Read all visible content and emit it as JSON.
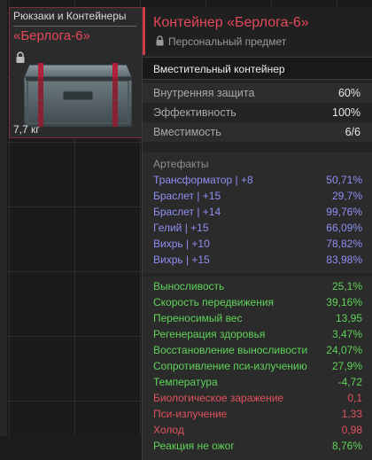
{
  "item_card": {
    "category": "Рюкзаки и Контейнеры",
    "name": "«Берлога-6»",
    "weight": "7,7 кг"
  },
  "tooltip": {
    "title": "Контейнер «Берлога-6»",
    "subtitle": "Персональный предмет",
    "type": "Вместительный контейнер",
    "stats": [
      {
        "label": "Внутренняя защита",
        "value": "60%"
      },
      {
        "label": "Эффективность",
        "value": "100%"
      },
      {
        "label": "Вместимость",
        "value": "6/6"
      }
    ],
    "artifacts_title": "Артефакты",
    "artifacts": [
      {
        "name": "Трансформатор | +8",
        "value": "50,71%"
      },
      {
        "name": "Браслет | +15",
        "value": "29,7%"
      },
      {
        "name": "Браслет | +14",
        "value": "99,76%"
      },
      {
        "name": "Гелий | +15",
        "value": "66,09%"
      },
      {
        "name": "Вихрь | +10",
        "value": "78,82%"
      },
      {
        "name": "Вихрь | +15",
        "value": "83,98%"
      }
    ],
    "effects": [
      {
        "label": "Выносливость",
        "value": "25,1%",
        "kind": "positive"
      },
      {
        "label": "Скорость передвижения",
        "value": "39,16%",
        "kind": "positive"
      },
      {
        "label": "Переносимый вес",
        "value": "13,95",
        "kind": "positive"
      },
      {
        "label": "Регенерация здоровья",
        "value": "3,47%",
        "kind": "positive"
      },
      {
        "label": "Восстановление выносливости",
        "value": "24,07%",
        "kind": "positive"
      },
      {
        "label": "Сопротивление пси-излучению",
        "value": "27,9%",
        "kind": "positive"
      },
      {
        "label": "Температура",
        "value": "-4,72",
        "kind": "positive"
      },
      {
        "label": "Биологическое заражение",
        "value": "0,1",
        "kind": "negative"
      },
      {
        "label": "Пси-излучение",
        "value": "1,33",
        "kind": "negative"
      },
      {
        "label": "Холод",
        "value": "0,98",
        "kind": "negative"
      },
      {
        "label": "Реакция не ожог",
        "value": "8,76%",
        "kind": "positive"
      }
    ]
  },
  "colors": {
    "accent": "#e5485a",
    "artifact": "#8f8ff5",
    "positive": "#5fd35a",
    "negative": "#e0525e"
  },
  "icons": [
    "lock-icon",
    "container-box-image"
  ]
}
